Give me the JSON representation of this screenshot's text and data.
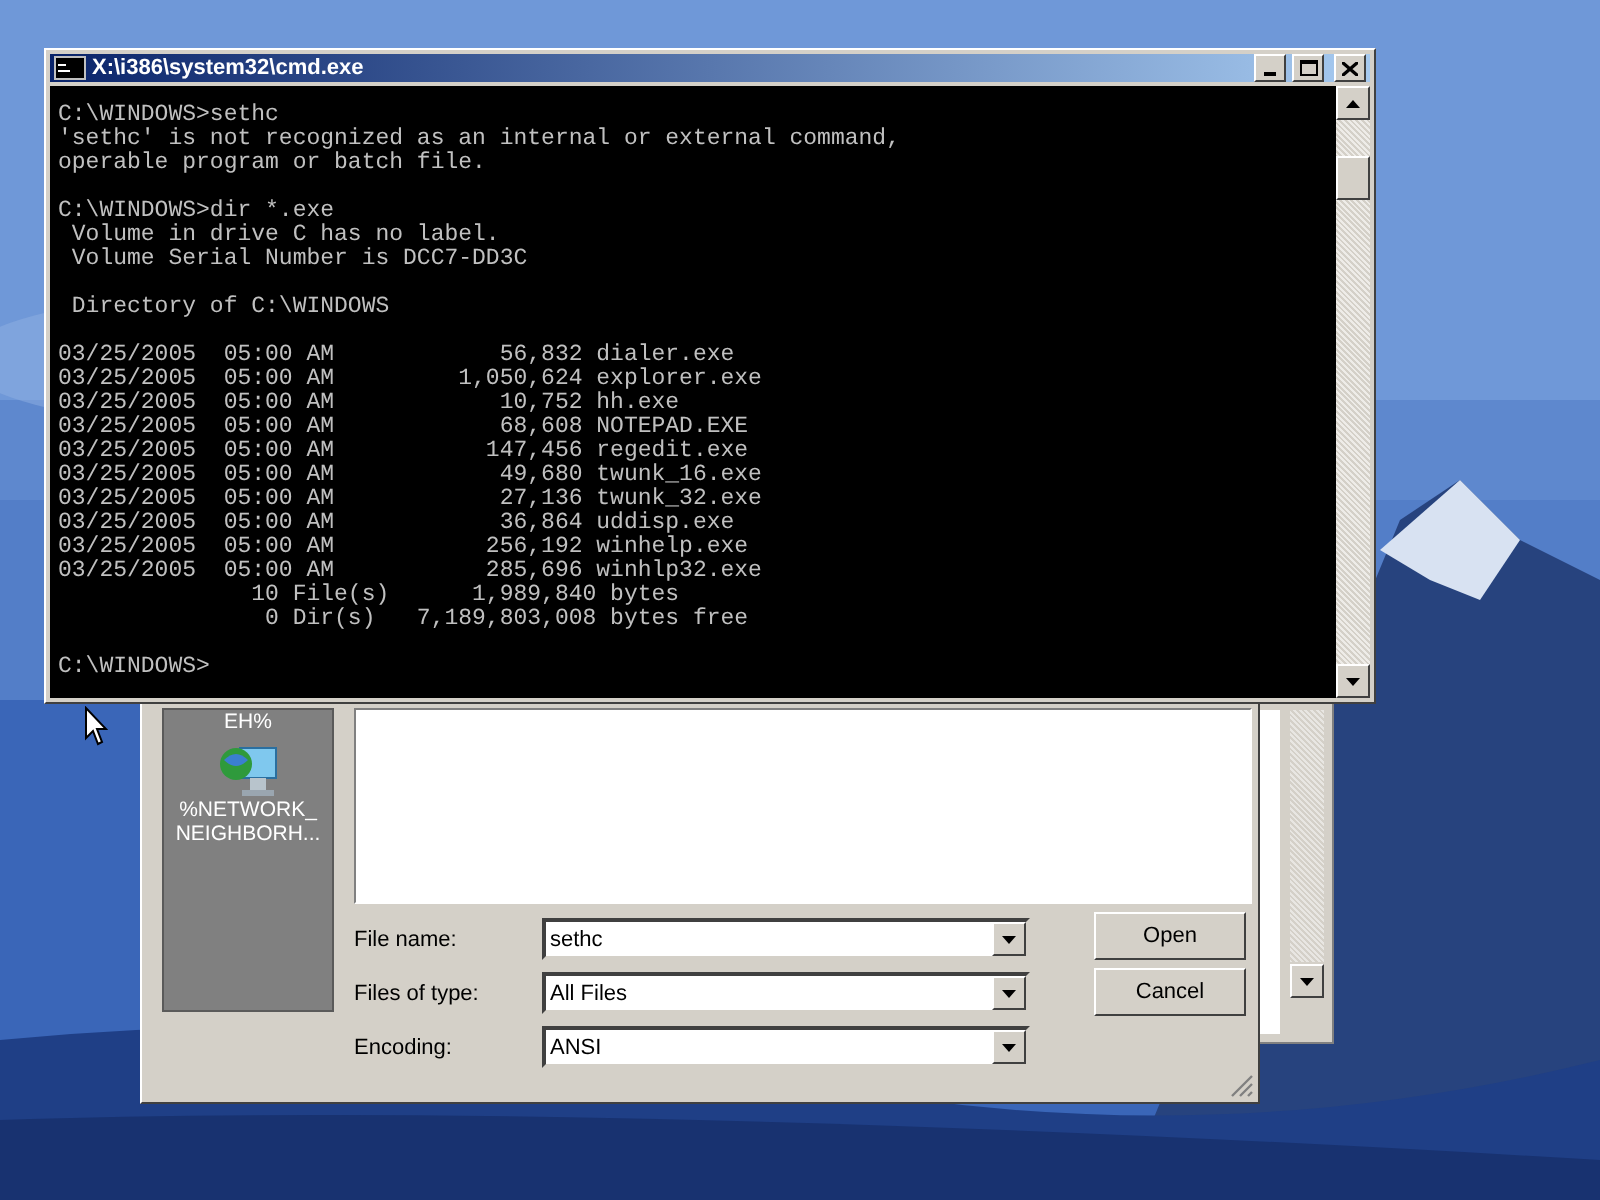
{
  "console_window": {
    "title": "X:\\i386\\system32\\cmd.exe",
    "blocks": [
      [
        "C:\\WINDOWS>sethc",
        "'sethc' is not recognized as an internal or external command,",
        "operable program or batch file."
      ],
      [
        "C:\\WINDOWS>dir *.exe",
        " Volume in drive C has no label.",
        " Volume Serial Number is DCC7-DD3C"
      ],
      [
        " Directory of C:\\WINDOWS"
      ],
      [
        "03/25/2005  05:00 AM            56,832 dialer.exe",
        "03/25/2005  05:00 AM         1,050,624 explorer.exe",
        "03/25/2005  05:00 AM            10,752 hh.exe",
        "03/25/2005  05:00 AM            68,608 NOTEPAD.EXE",
        "03/25/2005  05:00 AM           147,456 regedit.exe",
        "03/25/2005  05:00 AM            49,680 twunk_16.exe",
        "03/25/2005  05:00 AM            27,136 twunk_32.exe",
        "03/25/2005  05:00 AM            36,864 uddisp.exe",
        "03/25/2005  05:00 AM           256,192 winhelp.exe",
        "03/25/2005  05:00 AM           285,696 winhlp32.exe",
        "              10 File(s)      1,989,840 bytes",
        "               0 Dir(s)   7,189,803,008 bytes free"
      ],
      [
        "C:\\WINDOWS>"
      ]
    ]
  },
  "open_dialog": {
    "places": [
      {
        "label": "EH%",
        "kind": "cut"
      },
      {
        "label": "%NETWORK_ NEIGHBORH...",
        "kind": "network"
      }
    ],
    "fields": [
      {
        "label": "File name:",
        "value": "sethc"
      },
      {
        "label": "Files of type:",
        "value": "All Files"
      },
      {
        "label": "Encoding:",
        "value": "ANSI"
      }
    ],
    "buttons": [
      "Open",
      "Cancel"
    ]
  }
}
